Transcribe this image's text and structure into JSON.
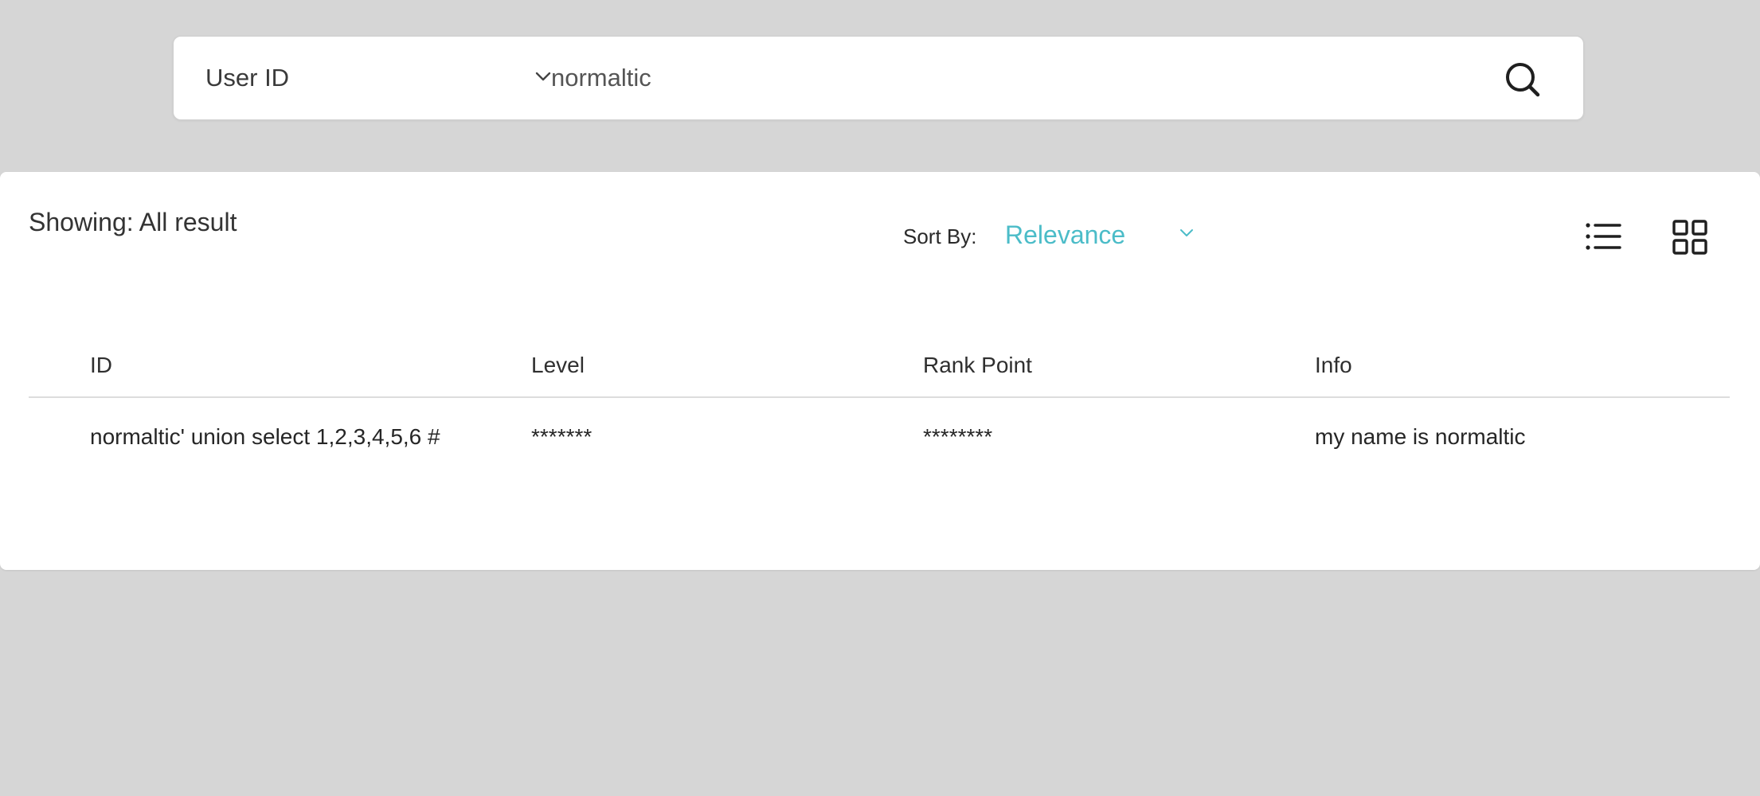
{
  "search": {
    "field_label": "User ID",
    "query": "normaltic",
    "placeholder": "",
    "icon": "search-icon"
  },
  "results": {
    "showing_text": "Showing: All result",
    "sort_label": "Sort By:",
    "sort_value": "Relevance",
    "accent_color": "#4bbcc8",
    "view_icons": [
      "list-view-icon",
      "grid-view-icon"
    ]
  },
  "table": {
    "headers": {
      "id": "ID",
      "level": "Level",
      "rank_point": "Rank Point",
      "info": "Info"
    },
    "rows": [
      {
        "id": "normaltic' union select 1,2,3,4,5,6 #",
        "level": "*******",
        "rank_point": "********",
        "info": "my name is normaltic"
      }
    ]
  }
}
